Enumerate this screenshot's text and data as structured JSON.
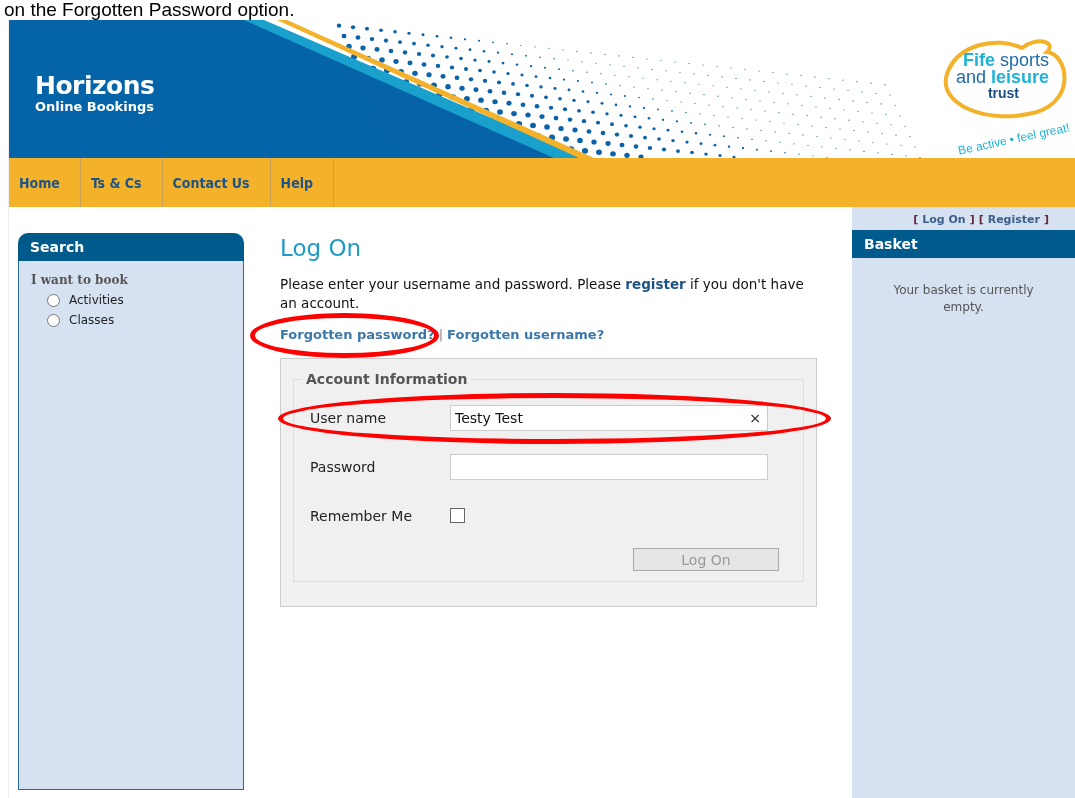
{
  "caption": "on the Forgotten Password option.",
  "header": {
    "title": "Horizons",
    "subtitle": "Online Bookings",
    "logo_lines": [
      "**Fife** sports",
      "and **leisure**",
      "trust"
    ],
    "tagline": "Be active • feel great!"
  },
  "nav": [
    {
      "label": "Home"
    },
    {
      "label": "Ts & Cs"
    },
    {
      "label": "Contact Us"
    },
    {
      "label": "Help"
    }
  ],
  "search": {
    "title": "Search",
    "heading": "I want to book",
    "options": [
      {
        "label": "Activities",
        "selected": false
      },
      {
        "label": "Classes",
        "selected": false
      }
    ]
  },
  "main": {
    "title": "Log On",
    "intro_before": "Please enter your username and password. Please",
    "intro_link": "register",
    "intro_after": "if you don't have an account.",
    "links": [
      {
        "label": "Forgotten password?",
        "circled": true
      },
      {
        "label": "Forgotten username?",
        "circled": false
      }
    ],
    "separator": "|",
    "form": {
      "legend": "Account Information",
      "fields": [
        {
          "kind": "text",
          "label": "User name",
          "value": "Testy Test",
          "clear": "×",
          "circled": true
        },
        {
          "kind": "password",
          "label": "Password",
          "circled": false
        },
        {
          "kind": "checkbox",
          "label": "Remember Me",
          "checked": false,
          "circled": false
        }
      ],
      "submit": {
        "label": "Log On",
        "disabled": true
      }
    }
  },
  "account_links": [
    {
      "open": "[",
      "label": "Log On",
      "close": "]"
    },
    {
      "open": "[",
      "label": "Register",
      "close": "]"
    }
  ],
  "basket": {
    "title": "Basket",
    "message": "Your basket is currently empty."
  }
}
